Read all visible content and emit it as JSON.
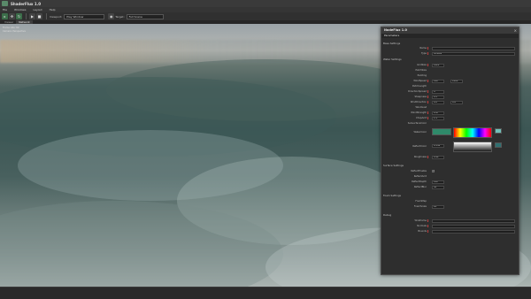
{
  "app": {
    "title": "ShaderFlux 1.0"
  },
  "menu": [
    "File",
    "Windows",
    "Layout",
    "Help"
  ],
  "toolbar": {
    "viewport_label": "Viewport:",
    "viewport_value": "Play Window",
    "target_label": "Target:",
    "target_value": "Full Scene"
  },
  "tabs": [
    "Viewer",
    "Network"
  ],
  "viewport": {
    "info_line1": "Frame rate: 60",
    "info_line2": "Camera: Perspective"
  },
  "panel": {
    "title": "NodeFlux 1.0",
    "tab": "Parameters",
    "sections": {
      "base": "Base Settings",
      "water": "Water Settings",
      "surface": "Surface Settings",
      "foam": "Foam Settings",
      "debug": "Debug"
    },
    "rows": [
      {
        "label": "Name",
        "value": ""
      },
      {
        "label": "Type",
        "value": "OCEAN"
      },
      {
        "label": "GridSize",
        "value": "1024"
      },
      {
        "label": "PatchSize",
        "value": ""
      },
      {
        "label": "Padding",
        "value": ""
      },
      {
        "label": "WindSpeed",
        "value": "100",
        "value2": "1000"
      },
      {
        "label": "PatchLength",
        "value": ""
      },
      {
        "label": "DirectionSpread",
        "value": "4"
      },
      {
        "label": "Steepness",
        "value": "0.5"
      },
      {
        "label": "WindDirection",
        "value": "0.2",
        "value2": "0.8"
      },
      {
        "label": "WindGust",
        "value": ""
      },
      {
        "label": "WindStrength",
        "value": "0.47"
      },
      {
        "label": "ChopAmt",
        "value": "1.1"
      },
      {
        "label": "SubsurfaceColor",
        "value": ""
      },
      {
        "label": "WaterColor",
        "value": "0.158"
      },
      {
        "label": "ReflectColor",
        "value": ""
      },
      {
        "label": "Roughness",
        "value": "0.42"
      },
      {
        "label": "Refraction",
        "value": "0.3"
      }
    ],
    "surface_rows": [
      {
        "label": "ReflectEnable",
        "value": "✓"
      },
      {
        "label": "ReflectAmt",
        "value": ""
      },
      {
        "label": "ReflectDepth",
        "value": "100"
      },
      {
        "label": "ReflectBlur",
        "value": "40"
      }
    ],
    "foam_rows": [
      {
        "label": "FoamMap",
        "value": ""
      },
      {
        "label": "FoamScale",
        "value": "20"
      }
    ],
    "debug_rows": [
      {
        "label": "Wireframe",
        "value": ""
      },
      {
        "label": "Normals",
        "value": ""
      },
      {
        "label": "Bounds",
        "value": ""
      }
    ]
  },
  "colors": {
    "water_color": "#2f8a6a",
    "reflect_color": "#2f6f70",
    "accent": "#c04040"
  }
}
